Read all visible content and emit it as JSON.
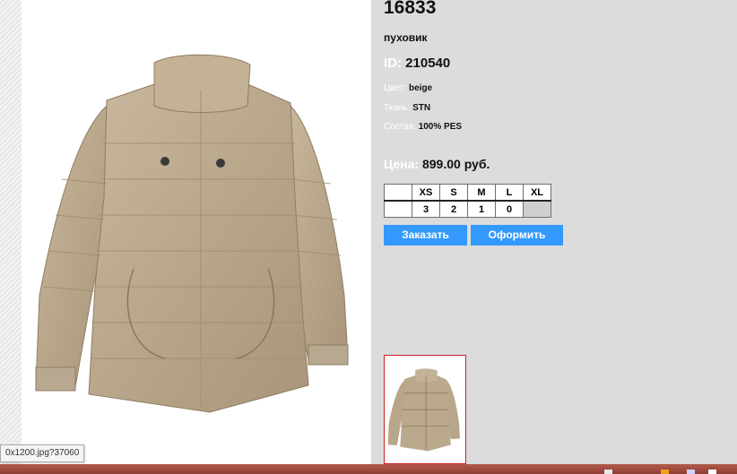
{
  "product": {
    "title": "16833",
    "subtitle": "пуховик",
    "id_label": "ID:",
    "id_value": "210540",
    "attributes": [
      {
        "label": "Цвет:",
        "value": "beige"
      },
      {
        "label": "Ткань:",
        "value": "STN"
      },
      {
        "label": "Состав:",
        "value": "100% PES"
      }
    ],
    "price_label": "Цена:",
    "price_value": "899.00 руб."
  },
  "sizes": {
    "headers": [
      "XS",
      "S",
      "M",
      "L",
      "XL"
    ],
    "quantities": [
      "3",
      "2",
      "1",
      "0",
      ""
    ]
  },
  "buttons": {
    "order": "Заказать",
    "checkout": "Оформить"
  },
  "status_tip": "0x1200.jpg?37060",
  "colors": {
    "info_bg": "#dcdcdc",
    "button": "#3399ff",
    "thumb_border": "#cc2222",
    "jacket": "#b9a68a"
  }
}
